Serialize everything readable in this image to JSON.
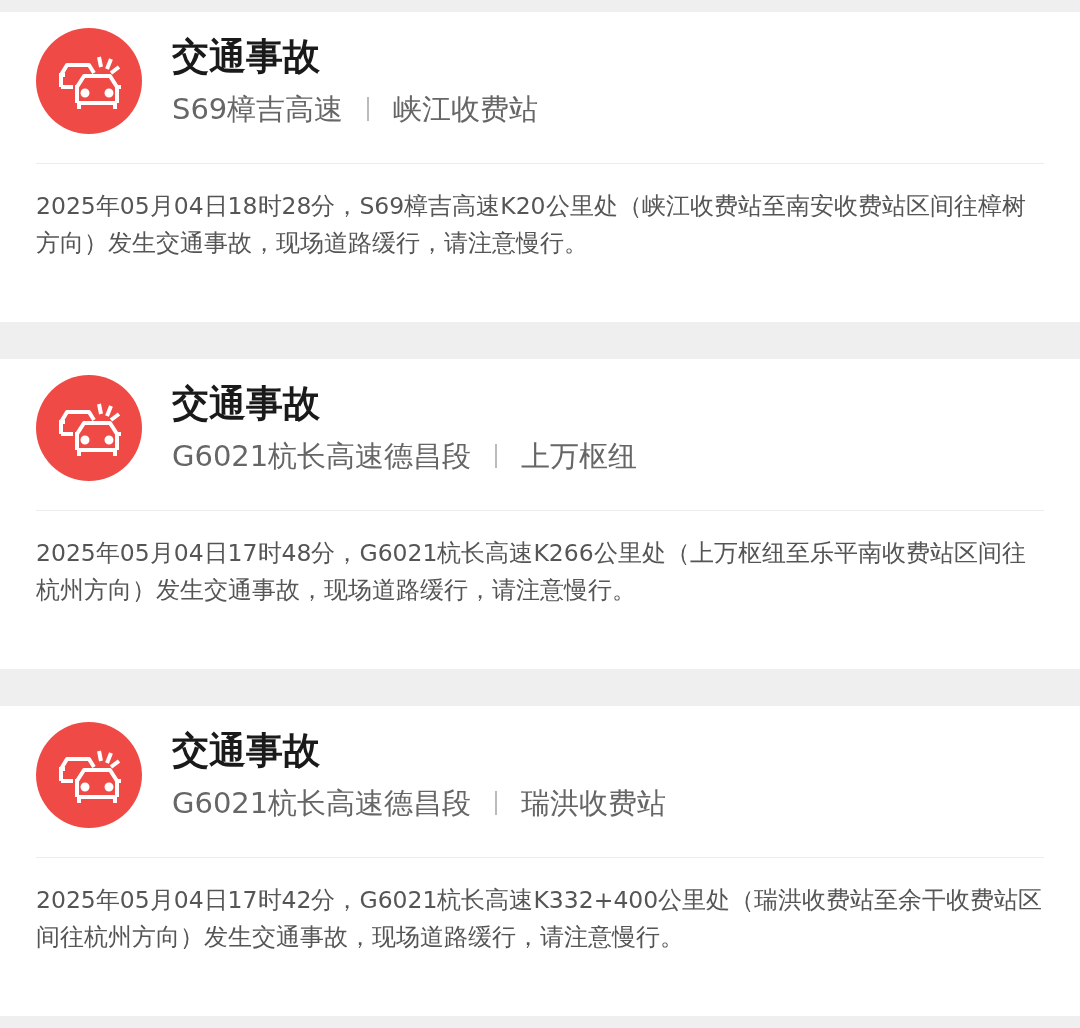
{
  "incidents": [
    {
      "title": "交通事故",
      "road": "S69樟吉高速",
      "location": "峡江收费站",
      "description": "2025年05月04日18时28分，S69樟吉高速K20公里处（峡江收费站至南安收费站区间往樟树方向）发生交通事故，现场道路缓行，请注意慢行。"
    },
    {
      "title": "交通事故",
      "road": "G6021杭长高速德昌段",
      "location": "上万枢纽",
      "description": "2025年05月04日17时48分，G6021杭长高速K266公里处（上万枢纽至乐平南收费站区间往杭州方向）发生交通事故，现场道路缓行，请注意慢行。"
    },
    {
      "title": "交通事故",
      "road": "G6021杭长高速德昌段",
      "location": "瑞洪收费站",
      "description": "2025年05月04日17时42分，G6021杭长高速K332+400公里处（瑞洪收费站至余干收费站区间往杭州方向）发生交通事故，现场道路缓行，请注意慢行。"
    }
  ]
}
